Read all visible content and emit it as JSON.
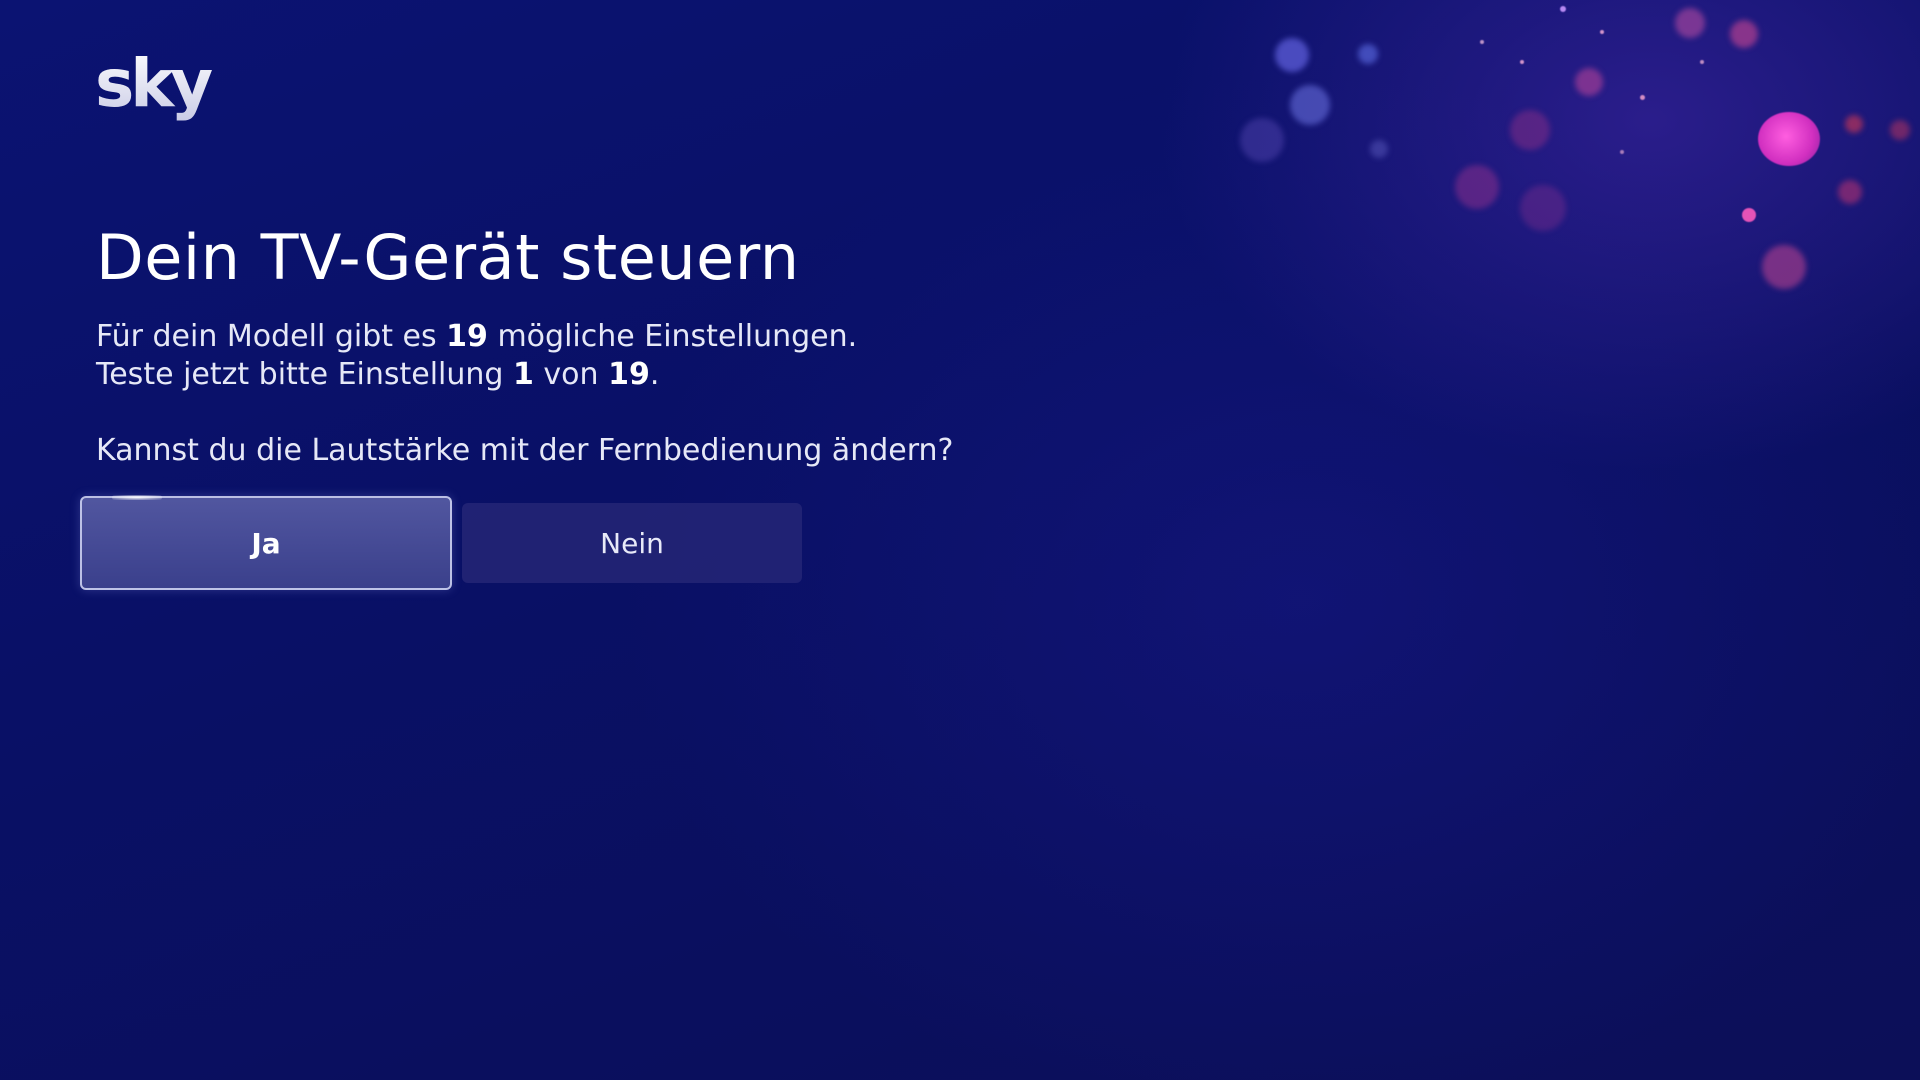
{
  "app": {
    "logo_text": "sky"
  },
  "screen": {
    "title": "Dein TV-Gerät steuern",
    "info_line1": {
      "prefix": "Für dein Modell gibt es ",
      "count": "19",
      "suffix": " mögliche Einstellungen."
    },
    "info_line2": {
      "prefix": "Teste jetzt bitte Einstellung ",
      "current": "1",
      "middle": " von ",
      "total": "19",
      "suffix": "."
    },
    "question": "Kannst du die Lautstärke mit der Fernbedienung ändern?"
  },
  "buttons": {
    "yes_label": "Ja",
    "no_label": "Nein",
    "focused": "yes"
  },
  "colors": {
    "background": "#0a1068",
    "accent_pink": "#e23cc8",
    "focus_border": "#d2d7f5"
  }
}
